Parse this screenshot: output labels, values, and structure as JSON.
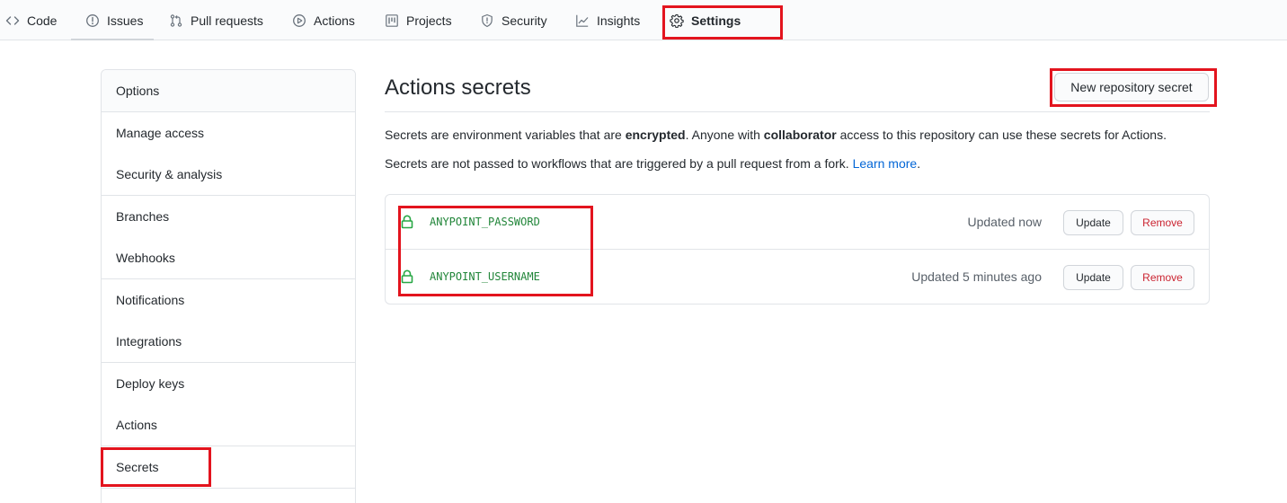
{
  "tabs": [
    {
      "label": "Code",
      "icon": "code-icon"
    },
    {
      "label": "Issues",
      "icon": "issue-icon"
    },
    {
      "label": "Pull requests",
      "icon": "pull-request-icon"
    },
    {
      "label": "Actions",
      "icon": "play-icon"
    },
    {
      "label": "Projects",
      "icon": "project-icon"
    },
    {
      "label": "Security",
      "icon": "shield-icon"
    },
    {
      "label": "Insights",
      "icon": "graph-icon"
    },
    {
      "label": "Settings",
      "icon": "gear-icon",
      "selected": true
    }
  ],
  "sidebar": {
    "items": [
      {
        "label": "Options"
      },
      {
        "label": "Manage access"
      },
      {
        "label": "Security & analysis"
      },
      {
        "label": "Branches"
      },
      {
        "label": "Webhooks"
      },
      {
        "label": "Notifications"
      },
      {
        "label": "Integrations"
      },
      {
        "label": "Deploy keys"
      },
      {
        "label": "Actions"
      },
      {
        "label": "Secrets",
        "selected": true
      }
    ]
  },
  "main": {
    "title": "Actions secrets",
    "new_secret_label": "New repository secret",
    "desc1": {
      "pre": "Secrets are environment variables that are ",
      "bold1": "encrypted",
      "mid": ". Anyone with ",
      "bold2": "collaborator",
      "post": " access to this repository can use these secrets for Actions."
    },
    "desc2": {
      "pre": "Secrets are not passed to workflows that are triggered by a pull request from a fork. ",
      "link": "Learn more",
      "post": "."
    },
    "secrets": [
      {
        "name": "ANYPOINT_PASSWORD",
        "updated": "Updated now",
        "update_label": "Update",
        "remove_label": "Remove",
        "icon": "lock-icon"
      },
      {
        "name": "ANYPOINT_USERNAME",
        "updated": "Updated 5 minutes ago",
        "update_label": "Update",
        "remove_label": "Remove",
        "icon": "lock-icon"
      }
    ]
  },
  "colors": {
    "highlight": "#e3141e",
    "secret_name": "#22863a",
    "link": "#0366d6",
    "remove": "#cb2431"
  }
}
